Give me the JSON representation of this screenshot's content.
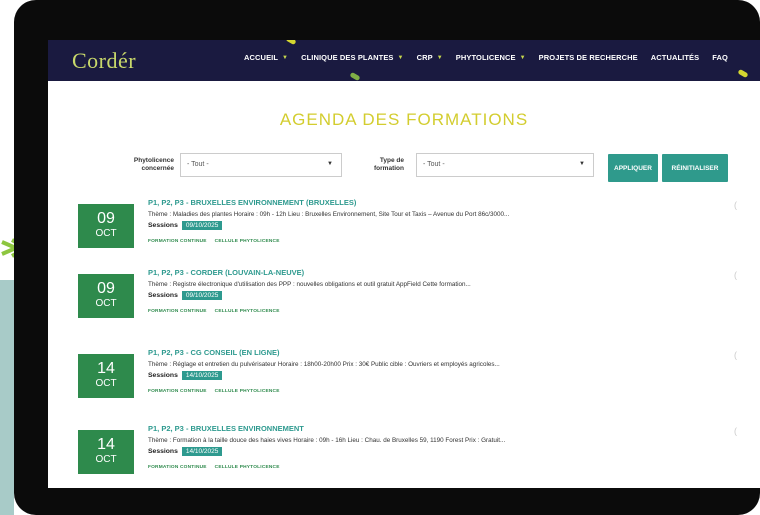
{
  "app": {
    "logo_text": "Cordér"
  },
  "nav": {
    "items": [
      {
        "label": "ACCUEIL",
        "has_dropdown": true
      },
      {
        "label": "CLINIQUE DES PLANTES",
        "has_dropdown": true
      },
      {
        "label": "CRP",
        "has_dropdown": true
      },
      {
        "label": "PHYTOLICENCE",
        "has_dropdown": true
      },
      {
        "label": "PROJETS DE RECHERCHE",
        "has_dropdown": false
      },
      {
        "label": "ACTUALITÉS",
        "has_dropdown": false
      },
      {
        "label": "FAQ",
        "has_dropdown": false
      }
    ]
  },
  "page": {
    "title": "AGENDA DES FORMATIONS"
  },
  "filters": {
    "phyto_label": "Phytolicence concernée",
    "phyto_value": "- Tout -",
    "type_label": "Type de formation",
    "type_value": "- Tout -",
    "apply_label": "APPLIQUER",
    "reset_label": "RÉINITIALISER"
  },
  "events": [
    {
      "day": "09",
      "month": "OCT",
      "title": "P1, P2, P3 - BRUXELLES ENVIRONNEMENT (BRUXELLES)",
      "description": "Thème : Maladies des plantes Horaire : 09h - 12h Lieu : Bruxelles Environnement, Site Tour et Taxis – Avenue du Port 86c/3000...",
      "sessions_label": "Sessions",
      "session_date": "09/10/2025",
      "tags": [
        "FORMATION CONTINUE",
        "CELLULE PHYTOLICENCE"
      ]
    },
    {
      "day": "09",
      "month": "OCT",
      "title": "P1, P2, P3 - CORDER (LOUVAIN-LA-NEUVE)",
      "description": "Thème : Registre électronique d'utilisation des PPP : nouvelles obligations et outil gratuit AppField Cette formation...",
      "sessions_label": "Sessions",
      "session_date": "09/10/2025",
      "tags": [
        "FORMATION CONTINUE",
        "CELLULE PHYTOLICENCE"
      ]
    },
    {
      "day": "14",
      "month": "OCT",
      "title": "P1, P2, P3 - CG CONSEIL (EN LIGNE)",
      "description": "Thème : Réglage et entretien du pulvérisateur Horaire : 18h00-20h00 Prix : 30€ Public cible : Ouvriers et employés agricoles...",
      "sessions_label": "Sessions",
      "session_date": "14/10/2025",
      "tags": [
        "FORMATION CONTINUE",
        "CELLULE PHYTOLICENCE"
      ]
    },
    {
      "day": "14",
      "month": "OCT",
      "title": "P1, P2, P3 - BRUXELLES ENVIRONNEMENT",
      "description": "Thème : Formation à la taille douce des haies vives Horaire : 09h - 16h Lieu : Chau. de Bruxelles 59, 1190 Forest Prix : Gratuit...",
      "sessions_label": "Sessions",
      "session_date": "14/10/2025",
      "tags": [
        "FORMATION CONTINUE",
        "CELLULE PHYTOLICENCE"
      ]
    }
  ],
  "colors": {
    "nav_bg": "#1a1a40",
    "title": "#d3cd2f",
    "date_box": "#2e8a4c",
    "accent_teal": "#2e9a8f",
    "button": "#2f9a8c"
  },
  "icons": {
    "arrow": "arrow-right-icon",
    "chevron": "chevron-down-icon"
  }
}
